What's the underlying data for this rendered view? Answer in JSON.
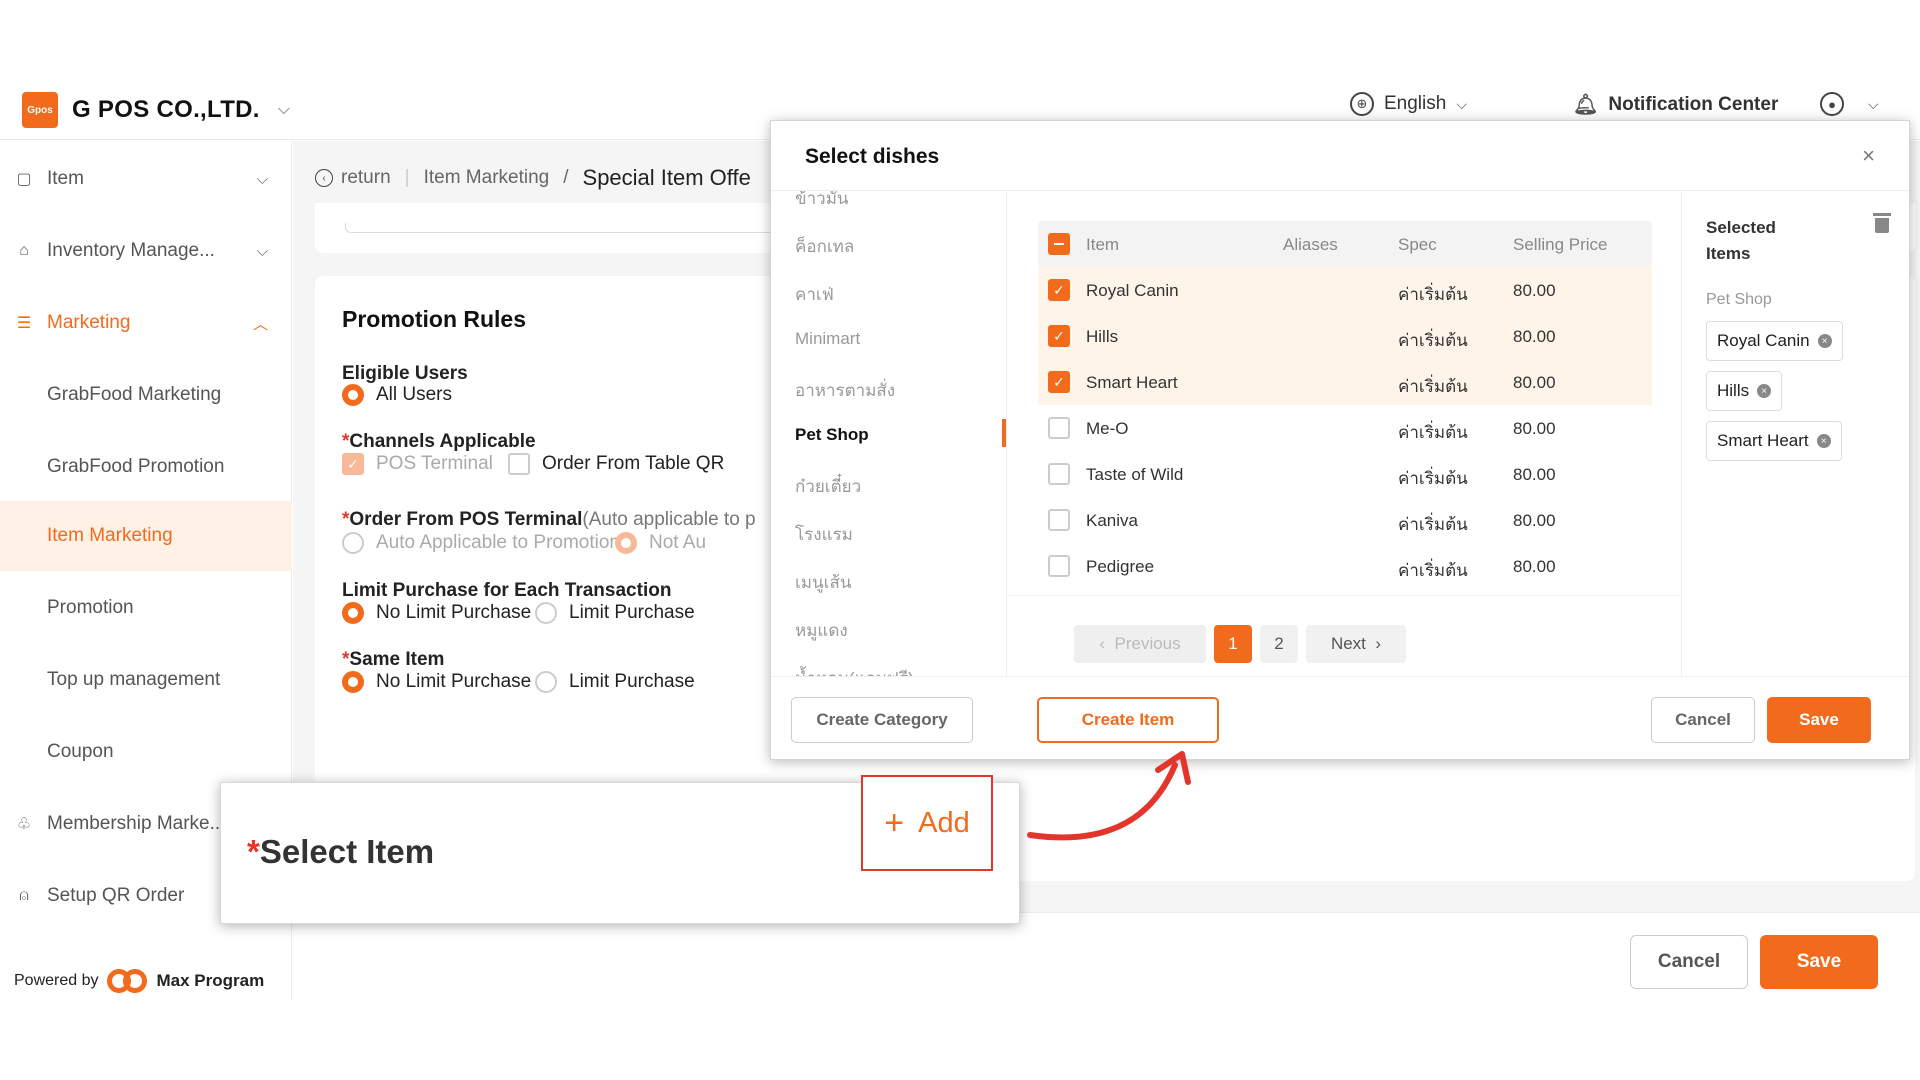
{
  "header": {
    "logo_text": "Gpos",
    "company": "G POS CO.,LTD.",
    "language": "English",
    "notification": "Notification Center"
  },
  "sidebar": {
    "items": [
      {
        "label": "Item",
        "icon": "box-icon"
      },
      {
        "label": "Inventory Manage...",
        "icon": "warehouse-icon"
      },
      {
        "label": "Marketing",
        "icon": "marketing-icon"
      },
      {
        "label": "GrabFood Marketing"
      },
      {
        "label": "GrabFood Promotion"
      },
      {
        "label": "Item Marketing"
      },
      {
        "label": "Promotion"
      },
      {
        "label": "Top up management"
      },
      {
        "label": "Coupon"
      },
      {
        "label": "Membership Marke...",
        "icon": "membership-icon"
      },
      {
        "label": "Setup QR Order",
        "icon": "bell-icon"
      }
    ],
    "powered_by": "Powered by",
    "powered_name": "Max Program"
  },
  "breadcrumb": {
    "return": "return",
    "parent": "Item Marketing",
    "separator": "/",
    "current": "Special Item Offe"
  },
  "promotion": {
    "title": "Promotion Rules",
    "eligible_users": {
      "label": "Eligible Users",
      "option": "All Users"
    },
    "channels": {
      "label": "Channels Applicable",
      "pos": "POS Terminal",
      "qr": "Order From Table QR"
    },
    "pos_terminal": {
      "label": "Order From POS Terminal",
      "hint": "(Auto applicable to p",
      "opt1": "Auto Applicable to Promotion",
      "opt2": "Not Au"
    },
    "limit_tx": {
      "label": "Limit Purchase for Each Transaction",
      "opt1": "No Limit Purchase",
      "opt2": "Limit Purchase"
    },
    "same_item": {
      "label": "Same Item",
      "opt1": "No Limit Purchase",
      "opt2": "Limit Purchase"
    },
    "required_mark": "*"
  },
  "footer": {
    "cancel": "Cancel",
    "save": "Save"
  },
  "modal": {
    "title": "Select dishes",
    "close": "×",
    "categories": [
      "ข้าวมัน",
      "ค็อกเทล",
      "คาเฟ่",
      "Minimart",
      "อาหารตามสั่ง",
      "Pet Shop",
      "ก๋วยเตี๋ยว",
      "โรงแรม",
      "เมนูเส้น",
      "หมูแดง",
      "น้ำหอม(แถมฟรี)"
    ],
    "active_category": "Pet Shop",
    "columns": {
      "item": "Item",
      "aliases": "Aliases",
      "spec": "Spec",
      "price": "Selling Price"
    },
    "rows": [
      {
        "item": "Royal Canin",
        "aliases": "",
        "spec": "ค่าเริ่มต้น",
        "price": "80.00",
        "checked": true
      },
      {
        "item": "Hills",
        "aliases": "",
        "spec": "ค่าเริ่มต้น",
        "price": "80.00",
        "checked": true
      },
      {
        "item": "Smart Heart",
        "aliases": "",
        "spec": "ค่าเริ่มต้น",
        "price": "80.00",
        "checked": true
      },
      {
        "item": "Me-O",
        "aliases": "",
        "spec": "ค่าเริ่มต้น",
        "price": "80.00",
        "checked": false
      },
      {
        "item": "Taste of Wild",
        "aliases": "",
        "spec": "ค่าเริ่มต้น",
        "price": "80.00",
        "checked": false
      },
      {
        "item": "Kaniva",
        "aliases": "",
        "spec": "ค่าเริ่มต้น",
        "price": "80.00",
        "checked": false
      },
      {
        "item": "Pedigree",
        "aliases": "",
        "spec": "ค่าเริ่มต้น",
        "price": "80.00",
        "checked": false
      }
    ],
    "pager": {
      "previous": "Previous",
      "pages": [
        "1",
        "2"
      ],
      "current": "1",
      "next": "Next"
    },
    "selected": {
      "title": "Selected Items",
      "group": "Pet Shop",
      "tags": [
        "Royal Canin",
        "Hills",
        "Smart Heart"
      ]
    },
    "buttons": {
      "create_category": "Create Category",
      "create_item": "Create Item",
      "cancel": "Cancel",
      "save": "Save"
    }
  },
  "callout": {
    "label": "Select Item",
    "required_mark": "*",
    "add": "Add",
    "add_icon": "+"
  },
  "colors": {
    "accent": "#f26a1b",
    "highlight_row": "#fef4ea",
    "active_nav_bg": "#fff1e6",
    "callout_border": "#e3352b"
  }
}
